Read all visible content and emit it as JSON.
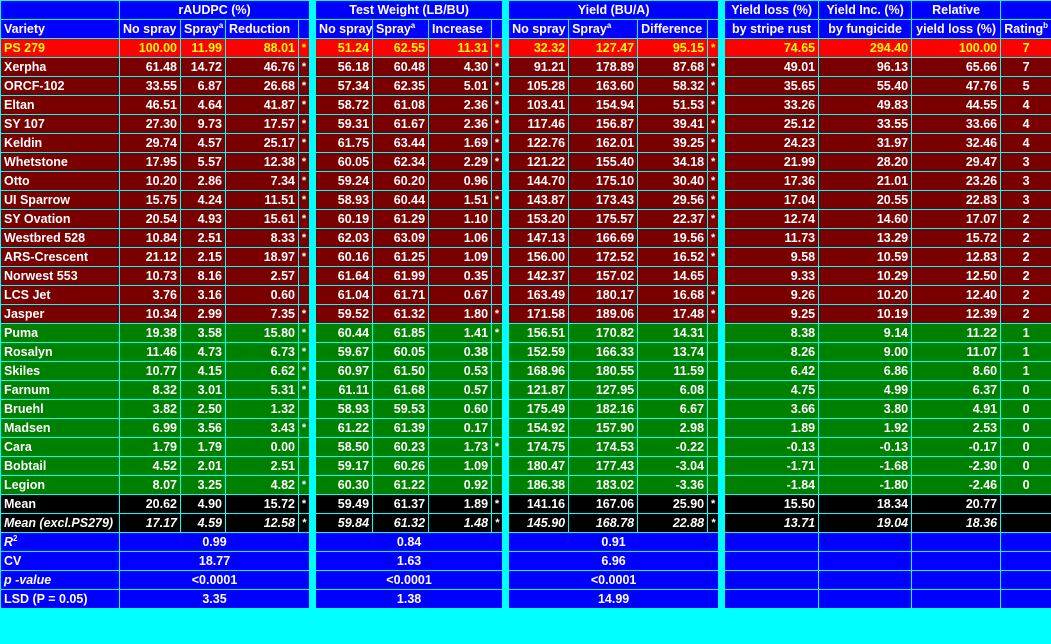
{
  "headers": {
    "variety": "Variety",
    "raudpc": "rAUDPC (%)",
    "test_weight": "Test Weight (LB/BU)",
    "yield": "Yield (BU/A)",
    "yield_loss": "Yield loss (%)",
    "yield_loss_sub": "by stripe rust",
    "yield_inc": "Yield Inc. (%)",
    "yield_inc_sub": "by fungicide",
    "relative": "Relative",
    "relative_sub": "yield loss (%)",
    "rating": "Rating",
    "rating_sup": "b",
    "no_spray": "No spray",
    "spray": "Spray",
    "spray_sup": "a",
    "reduction": "Reduction",
    "increase": "Increase",
    "difference": "Difference"
  },
  "rows": [
    {
      "v": "PS 279",
      "a1": "100.00",
      "a2": "11.99",
      "a3": "88.01",
      "as": "*",
      "t1": "51.24",
      "t2": "62.55",
      "t3": "11.31",
      "ts": "*",
      "y1": "32.32",
      "y2": "127.47",
      "y3": "95.15",
      "ys": "*",
      "yl": "74.65",
      "yi": "294.40",
      "ry": "100.00",
      "rt": "7",
      "cls": "r-hl"
    },
    {
      "v": "Xerpha",
      "a1": "61.48",
      "a2": "14.72",
      "a3": "46.76",
      "as": "*",
      "t1": "56.18",
      "t2": "60.48",
      "t3": "4.30",
      "ts": "*",
      "y1": "91.21",
      "y2": "178.89",
      "y3": "87.68",
      "ys": "*",
      "yl": "49.01",
      "yi": "96.13",
      "ry": "65.66",
      "rt": "7",
      "cls": "r-dark"
    },
    {
      "v": "ORCF-102",
      "a1": "33.55",
      "a2": "6.87",
      "a3": "26.68",
      "as": "*",
      "t1": "57.34",
      "t2": "62.35",
      "t3": "5.01",
      "ts": "*",
      "y1": "105.28",
      "y2": "163.60",
      "y3": "58.32",
      "ys": "*",
      "yl": "35.65",
      "yi": "55.40",
      "ry": "47.76",
      "rt": "5",
      "cls": "r-dark"
    },
    {
      "v": "Eltan",
      "a1": "46.51",
      "a2": "4.64",
      "a3": "41.87",
      "as": "*",
      "t1": "58.72",
      "t2": "61.08",
      "t3": "2.36",
      "ts": "*",
      "y1": "103.41",
      "y2": "154.94",
      "y3": "51.53",
      "ys": "*",
      "yl": "33.26",
      "yi": "49.83",
      "ry": "44.55",
      "rt": "4",
      "cls": "r-dark"
    },
    {
      "v": "SY 107",
      "a1": "27.30",
      "a2": "9.73",
      "a3": "17.57",
      "as": "*",
      "t1": "59.31",
      "t2": "61.67",
      "t3": "2.36",
      "ts": "*",
      "y1": "117.46",
      "y2": "156.87",
      "y3": "39.41",
      "ys": "*",
      "yl": "25.12",
      "yi": "33.55",
      "ry": "33.66",
      "rt": "4",
      "cls": "r-dark"
    },
    {
      "v": "Keldin",
      "a1": "29.74",
      "a2": "4.57",
      "a3": "25.17",
      "as": "*",
      "t1": "61.75",
      "t2": "63.44",
      "t3": "1.69",
      "ts": "*",
      "y1": "122.76",
      "y2": "162.01",
      "y3": "39.25",
      "ys": "*",
      "yl": "24.23",
      "yi": "31.97",
      "ry": "32.46",
      "rt": "4",
      "cls": "r-dark"
    },
    {
      "v": "Whetstone",
      "a1": "17.95",
      "a2": "5.57",
      "a3": "12.38",
      "as": "*",
      "t1": "60.05",
      "t2": "62.34",
      "t3": "2.29",
      "ts": "*",
      "y1": "121.22",
      "y2": "155.40",
      "y3": "34.18",
      "ys": "*",
      "yl": "21.99",
      "yi": "28.20",
      "ry": "29.47",
      "rt": "3",
      "cls": "r-dark"
    },
    {
      "v": "Otto",
      "a1": "10.20",
      "a2": "2.86",
      "a3": "7.34",
      "as": "*",
      "t1": "59.24",
      "t2": "60.20",
      "t3": "0.96",
      "ts": "",
      "y1": "144.70",
      "y2": "175.10",
      "y3": "30.40",
      "ys": "*",
      "yl": "17.36",
      "yi": "21.01",
      "ry": "23.26",
      "rt": "3",
      "cls": "r-dark"
    },
    {
      "v": "UI Sparrow",
      "a1": "15.75",
      "a2": "4.24",
      "a3": "11.51",
      "as": "*",
      "t1": "58.93",
      "t2": "60.44",
      "t3": "1.51",
      "ts": "*",
      "y1": "143.87",
      "y2": "173.43",
      "y3": "29.56",
      "ys": "*",
      "yl": "17.04",
      "yi": "20.55",
      "ry": "22.83",
      "rt": "3",
      "cls": "r-dark"
    },
    {
      "v": "SY Ovation",
      "a1": "20.54",
      "a2": "4.93",
      "a3": "15.61",
      "as": "*",
      "t1": "60.19",
      "t2": "61.29",
      "t3": "1.10",
      "ts": "",
      "y1": "153.20",
      "y2": "175.57",
      "y3": "22.37",
      "ys": "*",
      "yl": "12.74",
      "yi": "14.60",
      "ry": "17.07",
      "rt": "2",
      "cls": "r-dark"
    },
    {
      "v": "Westbred 528",
      "a1": "10.84",
      "a2": "2.51",
      "a3": "8.33",
      "as": "*",
      "t1": "62.03",
      "t2": "63.09",
      "t3": "1.06",
      "ts": "",
      "y1": "147.13",
      "y2": "166.69",
      "y3": "19.56",
      "ys": "*",
      "yl": "11.73",
      "yi": "13.29",
      "ry": "15.72",
      "rt": "2",
      "cls": "r-dark"
    },
    {
      "v": "ARS-Crescent",
      "a1": "21.12",
      "a2": "2.15",
      "a3": "18.97",
      "as": "*",
      "t1": "60.16",
      "t2": "61.25",
      "t3": "1.09",
      "ts": "",
      "y1": "156.00",
      "y2": "172.52",
      "y3": "16.52",
      "ys": "*",
      "yl": "9.58",
      "yi": "10.59",
      "ry": "12.83",
      "rt": "2",
      "cls": "r-dark"
    },
    {
      "v": "Norwest 553",
      "a1": "10.73",
      "a2": "8.16",
      "a3": "2.57",
      "as": "",
      "t1": "61.64",
      "t2": "61.99",
      "t3": "0.35",
      "ts": "",
      "y1": "142.37",
      "y2": "157.02",
      "y3": "14.65",
      "ys": "",
      "yl": "9.33",
      "yi": "10.29",
      "ry": "12.50",
      "rt": "2",
      "cls": "r-dark"
    },
    {
      "v": "LCS Jet",
      "a1": "3.76",
      "a2": "3.16",
      "a3": "0.60",
      "as": "",
      "t1": "61.04",
      "t2": "61.71",
      "t3": "0.67",
      "ts": "",
      "y1": "163.49",
      "y2": "180.17",
      "y3": "16.68",
      "ys": "*",
      "yl": "9.26",
      "yi": "10.20",
      "ry": "12.40",
      "rt": "2",
      "cls": "r-dark"
    },
    {
      "v": "Jasper",
      "a1": "10.34",
      "a2": "2.99",
      "a3": "7.35",
      "as": "*",
      "t1": "59.52",
      "t2": "61.32",
      "t3": "1.80",
      "ts": "*",
      "y1": "171.58",
      "y2": "189.06",
      "y3": "17.48",
      "ys": "*",
      "yl": "9.25",
      "yi": "10.19",
      "ry": "12.39",
      "rt": "2",
      "cls": "r-dark"
    },
    {
      "v": "Puma",
      "a1": "19.38",
      "a2": "3.58",
      "a3": "15.80",
      "as": "*",
      "t1": "60.44",
      "t2": "61.85",
      "t3": "1.41",
      "ts": "*",
      "y1": "156.51",
      "y2": "170.82",
      "y3": "14.31",
      "ys": "",
      "yl": "8.38",
      "yi": "9.14",
      "ry": "11.22",
      "rt": "1",
      "cls": "r-green"
    },
    {
      "v": "Rosalyn",
      "a1": "11.46",
      "a2": "4.73",
      "a3": "6.73",
      "as": "*",
      "t1": "59.67",
      "t2": "60.05",
      "t3": "0.38",
      "ts": "",
      "y1": "152.59",
      "y2": "166.33",
      "y3": "13.74",
      "ys": "",
      "yl": "8.26",
      "yi": "9.00",
      "ry": "11.07",
      "rt": "1",
      "cls": "r-green"
    },
    {
      "v": "Skiles",
      "a1": "10.77",
      "a2": "4.15",
      "a3": "6.62",
      "as": "*",
      "t1": "60.97",
      "t2": "61.50",
      "t3": "0.53",
      "ts": "",
      "y1": "168.96",
      "y2": "180.55",
      "y3": "11.59",
      "ys": "",
      "yl": "6.42",
      "yi": "6.86",
      "ry": "8.60",
      "rt": "1",
      "cls": "r-green"
    },
    {
      "v": "Farnum",
      "a1": "8.32",
      "a2": "3.01",
      "a3": "5.31",
      "as": "*",
      "t1": "61.11",
      "t2": "61.68",
      "t3": "0.57",
      "ts": "",
      "y1": "121.87",
      "y2": "127.95",
      "y3": "6.08",
      "ys": "",
      "yl": "4.75",
      "yi": "4.99",
      "ry": "6.37",
      "rt": "0",
      "cls": "r-green"
    },
    {
      "v": "Bruehl",
      "a1": "3.82",
      "a2": "2.50",
      "a3": "1.32",
      "as": "",
      "t1": "58.93",
      "t2": "59.53",
      "t3": "0.60",
      "ts": "",
      "y1": "175.49",
      "y2": "182.16",
      "y3": "6.67",
      "ys": "",
      "yl": "3.66",
      "yi": "3.80",
      "ry": "4.91",
      "rt": "0",
      "cls": "r-green"
    },
    {
      "v": "Madsen",
      "a1": "6.99",
      "a2": "3.56",
      "a3": "3.43",
      "as": "*",
      "t1": "61.22",
      "t2": "61.39",
      "t3": "0.17",
      "ts": "",
      "y1": "154.92",
      "y2": "157.90",
      "y3": "2.98",
      "ys": "",
      "yl": "1.89",
      "yi": "1.92",
      "ry": "2.53",
      "rt": "0",
      "cls": "r-green"
    },
    {
      "v": "Cara",
      "a1": "1.79",
      "a2": "1.79",
      "a3": "0.00",
      "as": "",
      "t1": "58.50",
      "t2": "60.23",
      "t3": "1.73",
      "ts": "*",
      "y1": "174.75",
      "y2": "174.53",
      "y3": "-0.22",
      "ys": "",
      "yl": "-0.13",
      "yi": "-0.13",
      "ry": "-0.17",
      "rt": "0",
      "cls": "r-green"
    },
    {
      "v": "Bobtail",
      "a1": "4.52",
      "a2": "2.01",
      "a3": "2.51",
      "as": "",
      "t1": "59.17",
      "t2": "60.26",
      "t3": "1.09",
      "ts": "",
      "y1": "180.47",
      "y2": "177.43",
      "y3": "-3.04",
      "ys": "",
      "yl": "-1.71",
      "yi": "-1.68",
      "ry": "-2.30",
      "rt": "0",
      "cls": "r-green"
    },
    {
      "v": "Legion",
      "a1": "8.07",
      "a2": "3.25",
      "a3": "4.82",
      "as": "*",
      "t1": "60.30",
      "t2": "61.22",
      "t3": "0.92",
      "ts": "",
      "y1": "186.38",
      "y2": "183.02",
      "y3": "-3.36",
      "ys": "",
      "yl": "-1.84",
      "yi": "-1.80",
      "ry": "-2.46",
      "rt": "0",
      "cls": "r-green"
    },
    {
      "v": "Mean",
      "a1": "20.62",
      "a2": "4.90",
      "a3": "15.72",
      "as": "*",
      "t1": "59.49",
      "t2": "61.37",
      "t3": "1.89",
      "ts": "*",
      "y1": "141.16",
      "y2": "167.06",
      "y3": "25.90",
      "ys": "*",
      "yl": "15.50",
      "yi": "18.34",
      "ry": "20.77",
      "rt": "",
      "cls": "r-black"
    },
    {
      "v": "Mean (excl.PS279)",
      "a1": "17.17",
      "a2": "4.59",
      "a3": "12.58",
      "as": "*",
      "t1": "59.84",
      "t2": "61.32",
      "t3": "1.48",
      "ts": "*",
      "y1": "145.90",
      "y2": "168.78",
      "y3": "22.88",
      "ys": "*",
      "yl": "13.71",
      "yi": "19.04",
      "ry": "18.36",
      "rt": "",
      "cls": "r-mean2"
    }
  ],
  "stats": [
    {
      "label": "R",
      "label_sup": "2",
      "label_italic": true,
      "a": "0.99",
      "t": "0.84",
      "y": "0.91"
    },
    {
      "label": "CV",
      "label_sup": "",
      "label_italic": false,
      "a": "18.77",
      "t": "1.63",
      "y": "6.96"
    },
    {
      "label": "p -value",
      "label_sup": "",
      "label_italic": true,
      "a": "<0.0001",
      "t": "<0.0001",
      "y": "<0.0001"
    },
    {
      "label": "LSD (P = 0.05)",
      "label_sup": "",
      "label_italic": false,
      "a": "3.35",
      "t": "1.38",
      "y": "14.99"
    }
  ]
}
